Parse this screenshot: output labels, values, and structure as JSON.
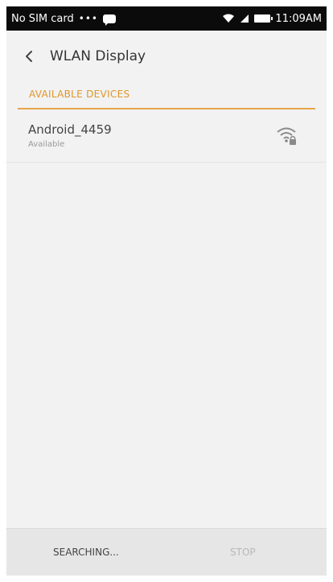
{
  "status_bar": {
    "carrier": "No SIM card",
    "dots": "•••",
    "time": "11:09AM"
  },
  "app_bar": {
    "title": "WLAN Display",
    "back_icon": "back-arrow-icon"
  },
  "section": {
    "header": "AVAILABLE DEVICES"
  },
  "devices": [
    {
      "name": "Android_4459",
      "status": "Available",
      "icon": "wifi-lock-icon"
    }
  ],
  "bottom_bar": {
    "status": "SEARCHING...",
    "stop_label": "STOP"
  },
  "colors": {
    "accent": "#e8a44a",
    "status_bar_bg": "#0b0b0b",
    "background": "#f2f2f2"
  }
}
